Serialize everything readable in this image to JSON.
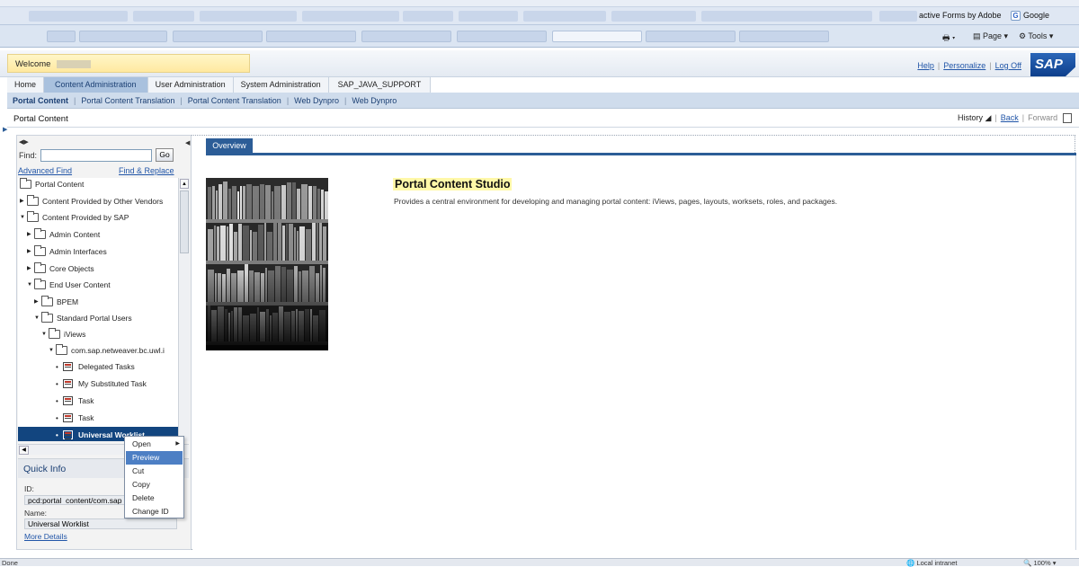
{
  "browser": {
    "adobe_bookmark": "active Forms by Adobe",
    "google_bookmark": "Google",
    "page_menu": "Page",
    "tools_menu": "Tools"
  },
  "header": {
    "welcome": "Welcome",
    "links": [
      "Help",
      "Personalize",
      "Log Off"
    ],
    "logo": "SAP"
  },
  "topnav": [
    "Home",
    "Content Administration",
    "User Administration",
    "System Administration",
    "SAP_JAVA_SUPPORT"
  ],
  "subnav": [
    "Portal Content",
    "Portal Content Translation",
    "Portal Content Translation",
    "Web Dynpro",
    "Web Dynpro"
  ],
  "page": {
    "title": "Portal Content",
    "history": "History",
    "back": "Back",
    "forward": "Forward"
  },
  "finder": {
    "find_label": "Find:",
    "find_value": "",
    "go": "Go",
    "advanced_find": "Advanced Find",
    "find_replace": "Find & Replace"
  },
  "tree": [
    {
      "label": "Portal Content",
      "toggle": ""
    },
    {
      "label": "Content Provided by Other Vendors",
      "toggle": "▶"
    },
    {
      "label": "Content Provided by SAP",
      "toggle": "▼"
    },
    {
      "label": "Admin Content",
      "toggle": "▶"
    },
    {
      "label": "Admin Interfaces",
      "toggle": "▶"
    },
    {
      "label": "Core Objects",
      "toggle": "▶"
    },
    {
      "label": "End User Content",
      "toggle": "▼"
    },
    {
      "label": "BPEM",
      "toggle": "▶"
    },
    {
      "label": "Standard Portal Users",
      "toggle": "▼"
    },
    {
      "label": "iViews",
      "toggle": "▼"
    },
    {
      "label": "com.sap.netweaver.bc.uwl.i",
      "toggle": "▼"
    },
    {
      "label": "Delegated Tasks",
      "toggle": "•"
    },
    {
      "label": "My Substituted Task",
      "toggle": "•"
    },
    {
      "label": "Task",
      "toggle": "•"
    },
    {
      "label": "Task",
      "toggle": "•"
    },
    {
      "label": "Universal Worklist",
      "toggle": "•"
    }
  ],
  "context_menu": [
    "Open",
    "Preview",
    "Cut",
    "Copy",
    "Delete",
    "Change ID"
  ],
  "quick_info": {
    "title": "Quick Info",
    "id_label": "ID:",
    "id_value": "pcd:portal_content/com.sap",
    "name_label": "Name:",
    "name_value": "Universal Worklist",
    "more_details": "More Details"
  },
  "content": {
    "tab": "Overview",
    "title": "Portal Content Studio",
    "description": "Provides a central environment for developing and managing portal content: iViews, pages, layouts, worksets, roles, and packages."
  },
  "status": {
    "left": "Done",
    "zone": "Local intranet",
    "zoom": "100%"
  }
}
